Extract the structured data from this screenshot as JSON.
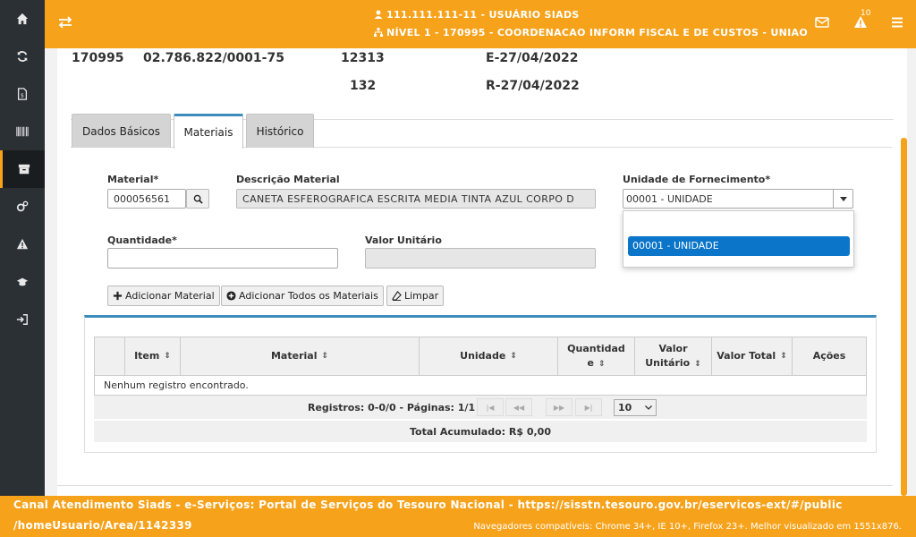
{
  "sidebar": {
    "items": [
      {
        "icon": "home-icon"
      },
      {
        "icon": "refresh-icon"
      },
      {
        "icon": "document-icon"
      },
      {
        "icon": "barcode-icon"
      },
      {
        "icon": "archive-icon",
        "active": true
      },
      {
        "icon": "gears-icon"
      },
      {
        "icon": "warning-icon"
      },
      {
        "icon": "graduation-cap-icon"
      },
      {
        "icon": "sign-in-icon"
      }
    ]
  },
  "header": {
    "user": "111.111.111-11 - USUÁRIO SIADS",
    "level": "NÍVEL 1 - 170995 - COORDENACAO INFORM FISCAL E DE CUSTOS - UNIAO",
    "notification_count": "10"
  },
  "info": {
    "code": "170995",
    "cnpj": "02.786.822/0001-75",
    "num1": "12313",
    "num2": "132",
    "date1": "E-27/04/2022",
    "date2": "R-27/04/2022"
  },
  "tabs": [
    {
      "label": "Dados Básicos"
    },
    {
      "label": "Materiais",
      "active": true
    },
    {
      "label": "Histórico"
    }
  ],
  "form": {
    "material_label": "Material*",
    "material_value": "000056561",
    "descricao_label": "Descrição Material",
    "descricao_value": "CANETA ESFEROGRAFICA ESCRITA MEDIA TINTA AZUL CORPO D",
    "unidade_label": "Unidade de Fornecimento*",
    "unidade_value": "00001 - UNIDADE",
    "unidade_option": "00001 - UNIDADE",
    "quantidade_label": "Quantidade*",
    "quantidade_value": "",
    "valor_label": "Valor Unitário",
    "valor_value": ""
  },
  "buttons": {
    "add": "Adicionar Material",
    "add_all": "Adicionar Todos os Materiais",
    "clear": "Limpar"
  },
  "table": {
    "columns": [
      "Item",
      "Material",
      "Unidade",
      "Quantidade",
      "Valor Unitário",
      "Valor Total",
      "Ações"
    ],
    "col_quant_1": "Quantidad",
    "col_quant_2": "e",
    "col_valor_1": "Valor",
    "col_valor_2": "Unitário",
    "empty": "Nenhum registro encontrado.",
    "pager_text": "Registros: 0-0/0 - Páginas: 1/1",
    "page_size": "10",
    "total": "Total Acumulado: R$ 0,00"
  },
  "footer": {
    "line1": "Canal Atendimento Siads - e-Serviços: Portal de Serviços do Tesouro Nacional - https://sisstn.tesouro.gov.br/eservicos-ext/#/public",
    "line2": "/homeUsuario/Area/1142339",
    "compat": "Navegadores compatíveis: Chrome 34+, IE 10+, Firefox 23+. Melhor visualizado em 1551x876."
  },
  "colors": {
    "brand": "#f7a21b",
    "sidebar": "#2b3035",
    "accent": "#3c8dbc",
    "selected_option": "#0a75c9"
  }
}
